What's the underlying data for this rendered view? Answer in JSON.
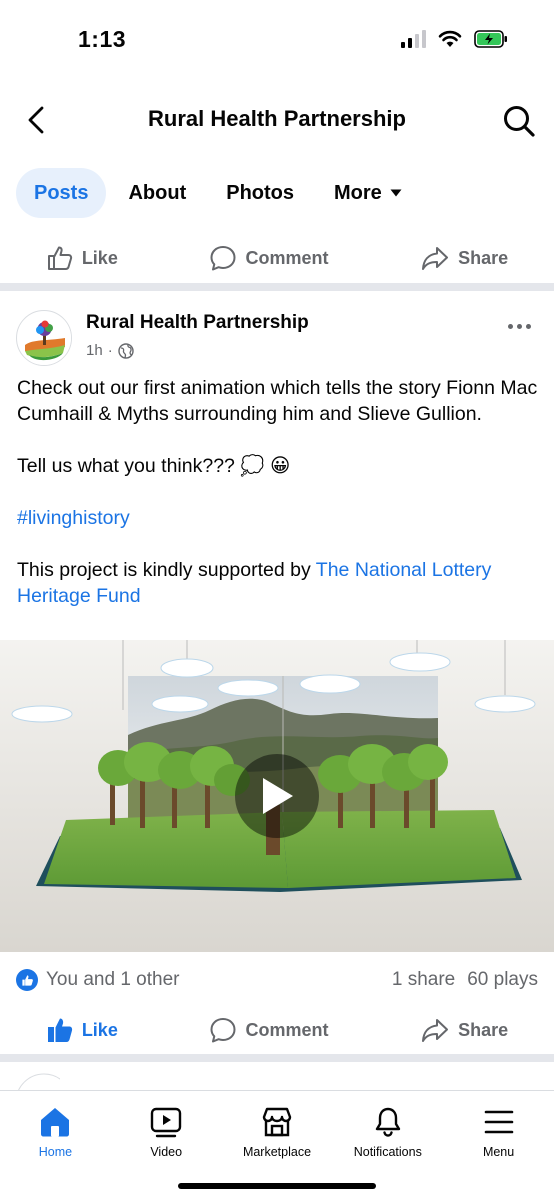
{
  "status": {
    "time": "1:13"
  },
  "header": {
    "title": "Rural Health Partnership"
  },
  "tabs": [
    {
      "label": "Posts",
      "active": true
    },
    {
      "label": "About",
      "active": false
    },
    {
      "label": "Photos",
      "active": false
    },
    {
      "label": "More",
      "active": false
    }
  ],
  "page_actions": {
    "like": "Like",
    "comment": "Comment",
    "share": "Share"
  },
  "post": {
    "author": "Rural Health Partnership",
    "time": "1h",
    "text_line1": "Check out our first animation which tells the story Fionn Mac Cumhaill & Myths surrounding him and Slieve Gullion.",
    "text_line2": "Tell us what you think??? 💭 😀",
    "hashtag": "#livinghistory",
    "support_prefix": "This project is kindly supported by ",
    "support_link": "The National Lottery Heritage Fund",
    "reactions": "You and 1 other",
    "shares": "1 share",
    "plays": "60 plays",
    "actions": {
      "like": "Like",
      "comment": "Comment",
      "share": "Share"
    }
  },
  "bottom_nav": [
    {
      "label": "Home",
      "icon": "home-icon",
      "active": true
    },
    {
      "label": "Video",
      "icon": "video-icon",
      "active": false
    },
    {
      "label": "Marketplace",
      "icon": "marketplace-icon",
      "active": false
    },
    {
      "label": "Notifications",
      "icon": "bell-icon",
      "active": false
    },
    {
      "label": "Menu",
      "icon": "menu-icon",
      "active": false
    }
  ],
  "colors": {
    "accent": "#1b74e4",
    "muted": "#65676b",
    "divider": "#e4e6eb"
  }
}
